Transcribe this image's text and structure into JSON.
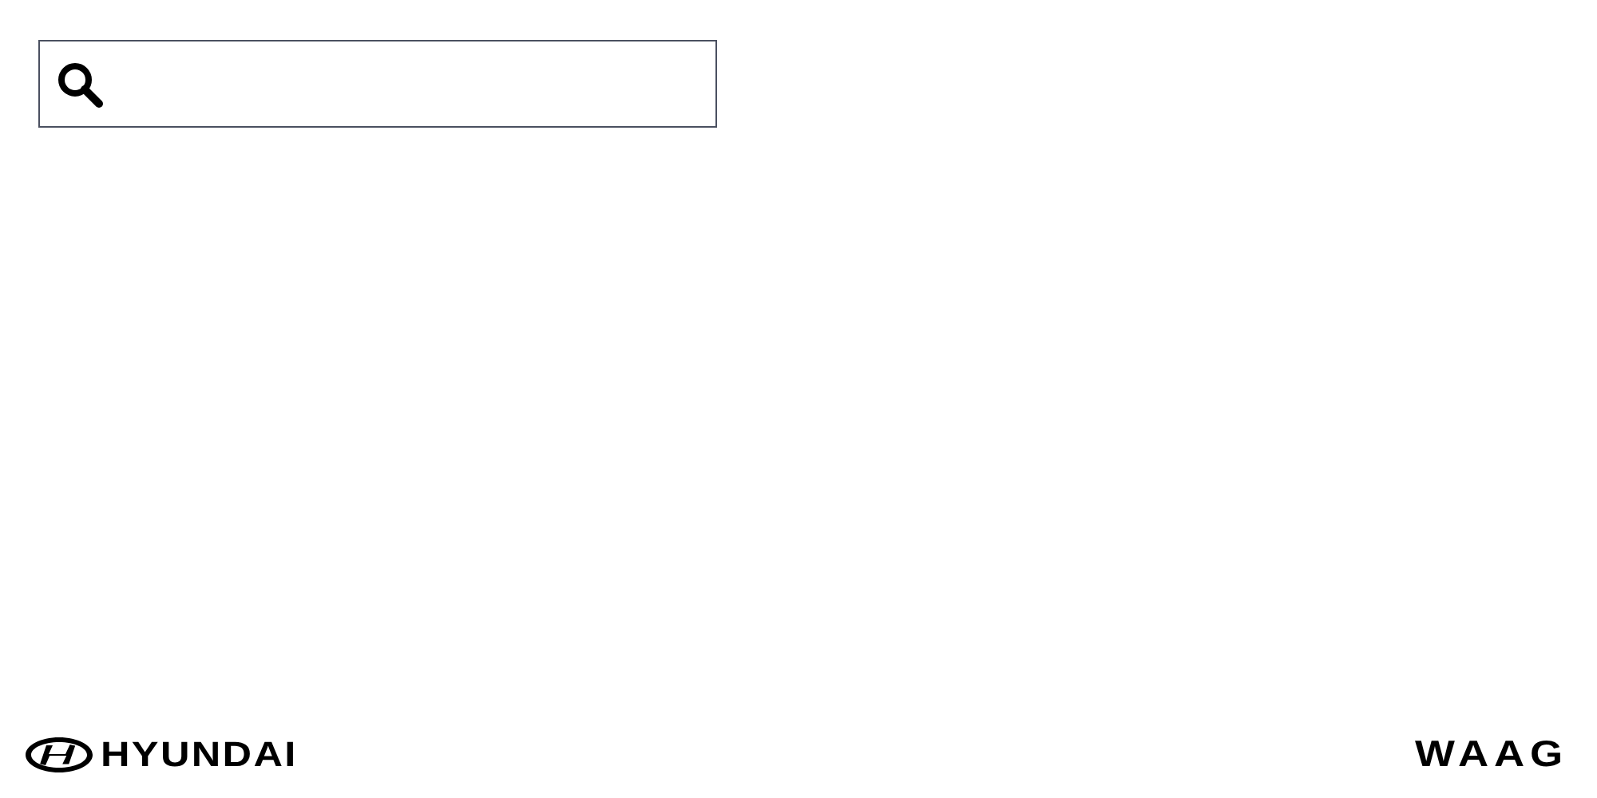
{
  "footer": {
    "logos": [
      {
        "kind": "emblem",
        "text": "HYUNDAI"
      },
      {
        "kind": "plain",
        "text": "WAAG"
      }
    ]
  }
}
